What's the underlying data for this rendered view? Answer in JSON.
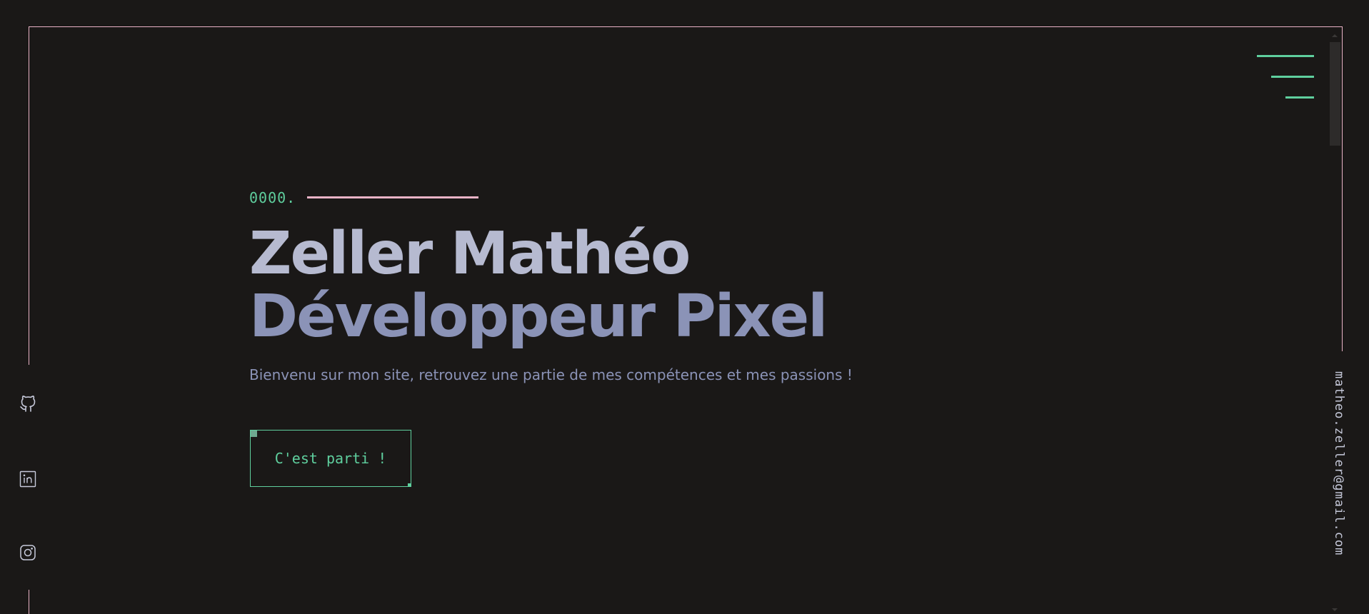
{
  "colors": {
    "background": "#1a1817",
    "accent_green": "#5fcf9e",
    "accent_pink": "#e9b3c6",
    "title_light": "#b6bad0",
    "title_muted": "#8b93b7"
  },
  "header": {
    "menu_icon": "hamburger-menu-icon"
  },
  "hero": {
    "section_number": "0000.",
    "title_line1": "Zeller Mathéo",
    "title_line2": "Développeur Pixel",
    "subtitle": "Bienvenu sur mon site, retrouvez une partie de mes compétences et mes passions !",
    "cta_label": "C'est parti !"
  },
  "social": {
    "items": [
      {
        "icon": "github-icon"
      },
      {
        "icon": "linkedin-icon"
      },
      {
        "icon": "instagram-icon"
      }
    ]
  },
  "contact": {
    "email": "matheo.zeller@gmail.com"
  }
}
